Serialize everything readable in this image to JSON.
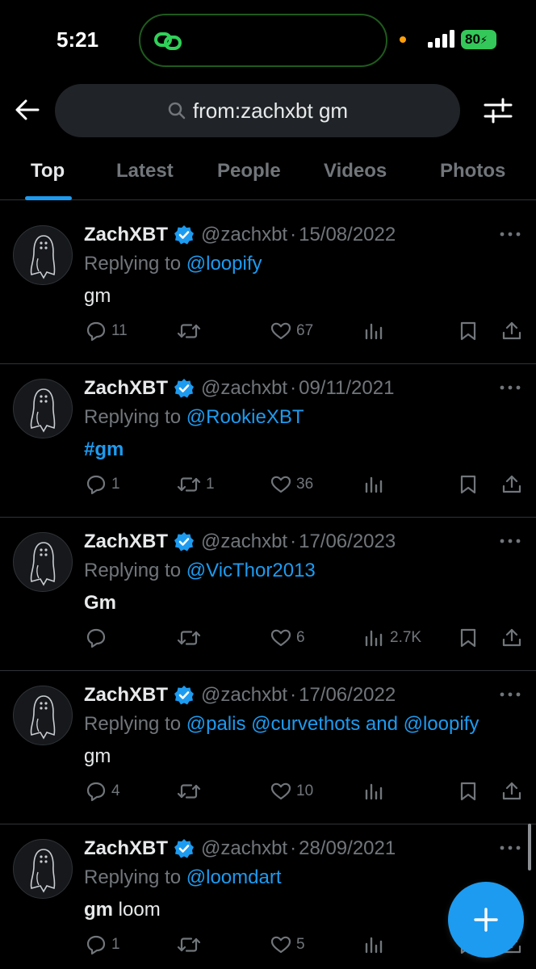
{
  "status": {
    "time": "5:21",
    "battery": "80"
  },
  "search": {
    "query": "from:zachxbt gm"
  },
  "tabs": [
    {
      "label": "Top",
      "active": true
    },
    {
      "label": "Latest"
    },
    {
      "label": "People"
    },
    {
      "label": "Videos"
    },
    {
      "label": "Photos"
    }
  ],
  "tweets": [
    {
      "name": "ZachXBT",
      "handle": "@zachxbt",
      "dot": "·",
      "date": "15/08/2022",
      "replying_prefix": "Replying to",
      "mentions": "@loopify",
      "body_bold": "",
      "body": "gm",
      "hashtag": "",
      "replies": "11",
      "retweets": "",
      "likes": "67",
      "views": ""
    },
    {
      "name": "ZachXBT",
      "handle": "@zachxbt",
      "dot": "·",
      "date": "09/11/2021",
      "replying_prefix": "Replying to",
      "mentions": "@RookieXBT",
      "body_bold": "",
      "body": "",
      "hashtag": "#gm",
      "replies": "1",
      "retweets": "1",
      "likes": "36",
      "views": ""
    },
    {
      "name": "ZachXBT",
      "handle": "@zachxbt",
      "dot": "·",
      "date": "17/06/2023",
      "replying_prefix": "Replying to",
      "mentions": "@VicThor2013",
      "body_bold": "Gm",
      "body": "",
      "hashtag": "",
      "replies": "",
      "retweets": "",
      "likes": "6",
      "views": "2.7K"
    },
    {
      "name": "ZachXBT",
      "handle": "@zachxbt",
      "dot": "·",
      "date": "17/06/2022",
      "replying_prefix": "Replying to",
      "mentions": "@palis @curvethots and @loopify",
      "body_bold": "",
      "body": "gm",
      "hashtag": "",
      "replies": "4",
      "retweets": "",
      "likes": "10",
      "views": ""
    },
    {
      "name": "ZachXBT",
      "handle": "@zachxbt",
      "dot": "·",
      "date": "28/09/2021",
      "replying_prefix": "Replying to",
      "mentions": "@loomdart",
      "body_bold": "gm",
      "body": " loom",
      "hashtag": "",
      "replies": "1",
      "retweets": "",
      "likes": "5",
      "views": ""
    }
  ],
  "colors": {
    "accent": "#1d9bf0",
    "muted": "#71767b",
    "text": "#e7e9ea",
    "background": "#000000",
    "battery": "#34c759"
  }
}
